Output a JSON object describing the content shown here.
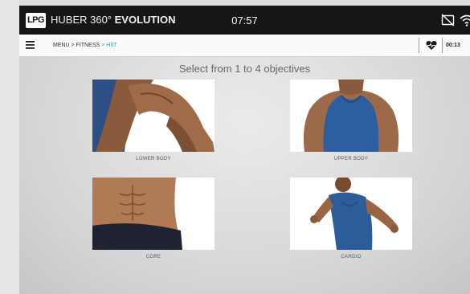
{
  "statusbar": {
    "logo_text": "LPG",
    "brand_prefix": "HUBER 360°",
    "brand_emphasis": "EVOLUTION",
    "time": "07:57",
    "icons": [
      "cast-off-icon",
      "wifi-icon"
    ]
  },
  "navbar": {
    "menu_icon": "hamburger-menu-icon",
    "breadcrumb": {
      "items": [
        "MENU",
        "FITNESS"
      ],
      "current": "HIIT",
      "separator": ">"
    },
    "heart_icon": "heart-rate-icon",
    "timer": "00:13"
  },
  "main": {
    "prompt": "Select from 1 to 4 objectives",
    "objectives": [
      {
        "label": "LOWER BODY"
      },
      {
        "label": "UPPER BODY"
      },
      {
        "label": "CORE"
      },
      {
        "label": "CARDIO"
      }
    ]
  },
  "colors": {
    "statusbar_bg": "#161616",
    "accent": "#2a9ec5",
    "navbar_bg": "#fafafa",
    "screen_bg": "#dcdcdc"
  }
}
